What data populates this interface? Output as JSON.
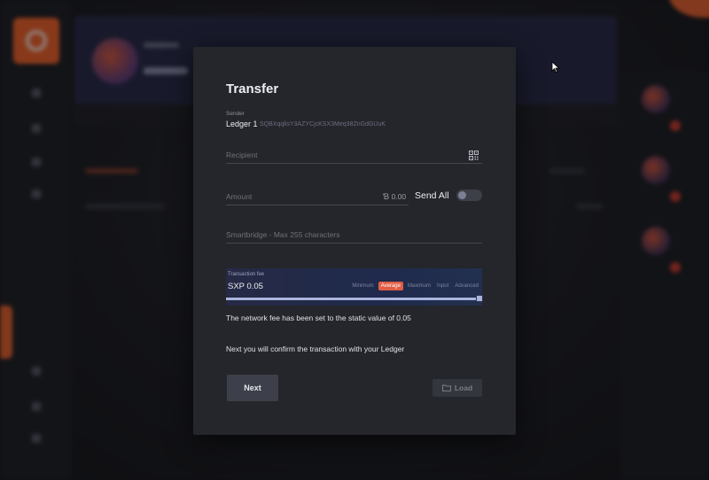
{
  "modal": {
    "title": "Transfer",
    "sender": {
      "label": "Sender",
      "name": "Ledger 1",
      "address": "SQBXqqlisY3AZYCjcKSX3Meq38ZnGdGUuK"
    },
    "recipient": {
      "placeholder": "Recipient"
    },
    "amount": {
      "placeholder": "Amount",
      "currency_symbol": "Ɓ",
      "value": "0.00",
      "send_all_label": "Send All",
      "send_all_on": false
    },
    "smartbridge": {
      "placeholder": "Smartbridge - Max 255 characters"
    },
    "fee": {
      "label": "Transaction fee",
      "value": "SXP 0.05",
      "options": [
        "Minimum",
        "Average",
        "Maximum",
        "Input",
        "Advanced"
      ],
      "selected": "Average",
      "slider_level": 1.0
    },
    "notes": {
      "fee_note": "The network fee has been set to the static value of 0.05",
      "confirm_note": "Next you will confirm the transaction with your Ledger"
    },
    "buttons": {
      "next": "Next",
      "load": "Load",
      "close_symbol": "✕"
    }
  },
  "colors": {
    "modal_bg": "#25262b",
    "accent": "#e05d45",
    "fee_slider": "#aab4dc"
  }
}
